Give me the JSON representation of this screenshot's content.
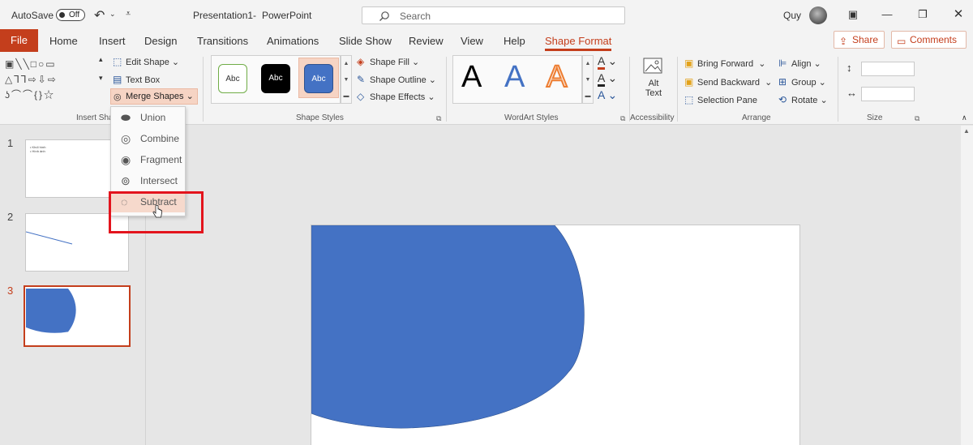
{
  "titlebar": {
    "autosave_label": "AutoSave",
    "autosave_state": "Off",
    "doc_title": "Presentation1",
    "separator": "-",
    "app_name": "PowerPoint",
    "search_placeholder": "Search",
    "user_name": "Quy"
  },
  "tabs": {
    "file": "File",
    "home": "Home",
    "insert": "Insert",
    "design": "Design",
    "transitions": "Transitions",
    "animations": "Animations",
    "slide_show": "Slide Show",
    "review": "Review",
    "view": "View",
    "help": "Help",
    "shape_format": "Shape Format",
    "share": "Share",
    "comments": "Comments"
  },
  "ribbon": {
    "insert_shapes": {
      "label": "Insert Sha",
      "edit_shape": "Edit Shape",
      "text_box": "Text Box",
      "merge_shapes": "Merge Shapes"
    },
    "shape_styles": {
      "label": "Shape Styles",
      "style_sample": "Abc",
      "shape_fill": "Shape Fill",
      "shape_outline": "Shape Outline",
      "shape_effects": "Shape Effects"
    },
    "wordart": {
      "label": "WordArt Styles",
      "sample": "A"
    },
    "accessibility": {
      "label": "Accessibility",
      "alt_text_line1": "Alt",
      "alt_text_line2": "Text"
    },
    "arrange": {
      "label": "Arrange",
      "bring_forward": "Bring Forward",
      "send_backward": "Send Backward",
      "selection_pane": "Selection Pane",
      "align": "Align",
      "group": "Group",
      "rotate": "Rotate"
    },
    "size": {
      "label": "Size"
    }
  },
  "merge_menu": {
    "items": [
      "Union",
      "Combine",
      "Fragment",
      "Intersect",
      "Subtract"
    ],
    "hovered": "Subtract"
  },
  "thumbnails": {
    "numbers": [
      "1",
      "2",
      "3"
    ],
    "selected": "3",
    "slide1_lines": [
      "• Khối hình",
      "• Hình ảnh"
    ]
  },
  "colors": {
    "accent": "#c43e1c",
    "shape_fill": "#4472c4",
    "highlight_box": "#e3141d"
  }
}
